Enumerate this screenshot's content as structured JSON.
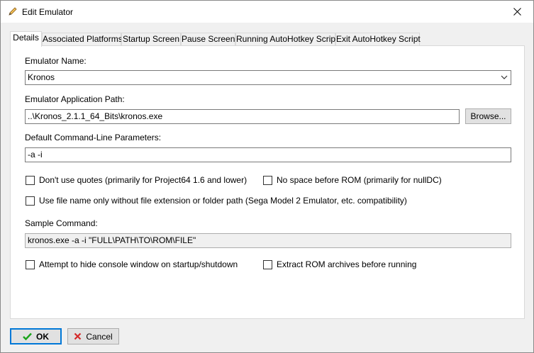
{
  "window": {
    "title": "Edit Emulator",
    "title_icon": "pencil-icon",
    "close_icon": "close-icon"
  },
  "tabs": [
    {
      "label": "Details",
      "active": true
    },
    {
      "label": "Associated Platforms",
      "active": false
    },
    {
      "label": "Startup Screen",
      "active": false
    },
    {
      "label": "Pause Screen",
      "active": false
    },
    {
      "label": "Running AutoHotkey Script",
      "active": false
    },
    {
      "label": "Exit AutoHotkey Script",
      "active": false
    }
  ],
  "details": {
    "emulator_name_label": "Emulator Name:",
    "emulator_name_value": "Kronos",
    "app_path_label": "Emulator Application Path:",
    "app_path_value": "..\\Kronos_2.1.1_64_Bits\\kronos.exe",
    "browse_label": "Browse...",
    "cmd_params_label": "Default Command-Line Parameters:",
    "cmd_params_value": "-a -i",
    "chk_no_quotes": "Don't use quotes (primarily for Project64 1.6 and lower)",
    "chk_no_space": "No space before ROM (primarily for nullDC)",
    "chk_file_name_only": "Use file name only without file extension or folder path (Sega Model 2 Emulator, etc. compatibility)",
    "sample_cmd_label": "Sample Command:",
    "sample_cmd_value": "kronos.exe -a -i \"FULL\\PATH\\TO\\ROM\\FILE\"",
    "chk_hide_console": "Attempt to hide console window on startup/shutdown",
    "chk_extract_rom": "Extract ROM archives before running"
  },
  "footer": {
    "ok_label": "OK",
    "ok_icon": "checkmark-icon",
    "cancel_label": "Cancel",
    "cancel_icon": "cancel-x-icon"
  },
  "colors": {
    "ok_check": "#1aa31a",
    "cancel_x": "#d42a2a",
    "focus_border": "#0078d7"
  }
}
